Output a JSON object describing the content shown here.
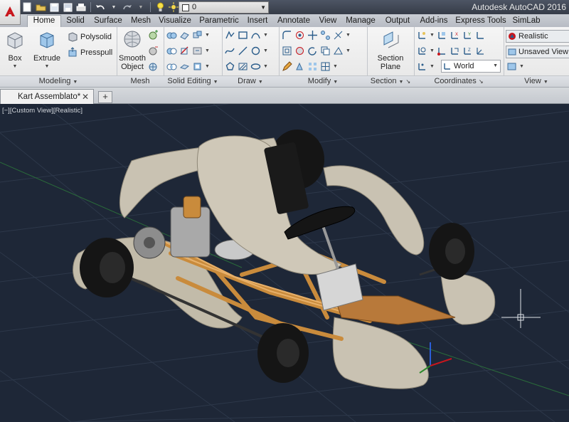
{
  "app": {
    "title": "Autodesk AutoCAD 2016"
  },
  "quick_access": {
    "layer_value": "0"
  },
  "ribbon_tabs": [
    {
      "label": "Home"
    },
    {
      "label": "Solid"
    },
    {
      "label": "Surface"
    },
    {
      "label": "Mesh"
    },
    {
      "label": "Visualize"
    },
    {
      "label": "Parametric"
    },
    {
      "label": "Insert"
    },
    {
      "label": "Annotate"
    },
    {
      "label": "View"
    },
    {
      "label": "Manage"
    },
    {
      "label": "Output"
    },
    {
      "label": "Add-ins"
    },
    {
      "label": "Express Tools"
    },
    {
      "label": "SimLab"
    }
  ],
  "ribbon": {
    "modeling": {
      "title": "Modeling",
      "box_label": "Box",
      "extrude_label": "Extrude",
      "polysolid_label": "Polysolid",
      "presspull_label": "Presspull"
    },
    "mesh": {
      "title": "Mesh",
      "smooth_object_label_1": "Smooth",
      "smooth_object_label_2": "Object"
    },
    "solid_editing": {
      "title": "Solid Editing"
    },
    "draw": {
      "title": "Draw"
    },
    "modify": {
      "title": "Modify"
    },
    "section": {
      "title": "Section",
      "section_plane_label_1": "Section",
      "section_plane_label_2": "Plane"
    },
    "coordinates": {
      "title": "Coordinates",
      "ucs_value": "World"
    },
    "view": {
      "title": "View",
      "visual_style_value": "Realistic",
      "named_view_value": "Unsaved View"
    }
  },
  "document": {
    "tab_label": "Kart Assemblato*"
  },
  "viewport": {
    "label": "[−][Custom View][Realistic]"
  },
  "colors": {
    "background": "#1e2737",
    "grid": "#2f3a4c",
    "body_panels": "#c9c2b2",
    "frame": "#c98b3c",
    "tires": "#151515"
  }
}
